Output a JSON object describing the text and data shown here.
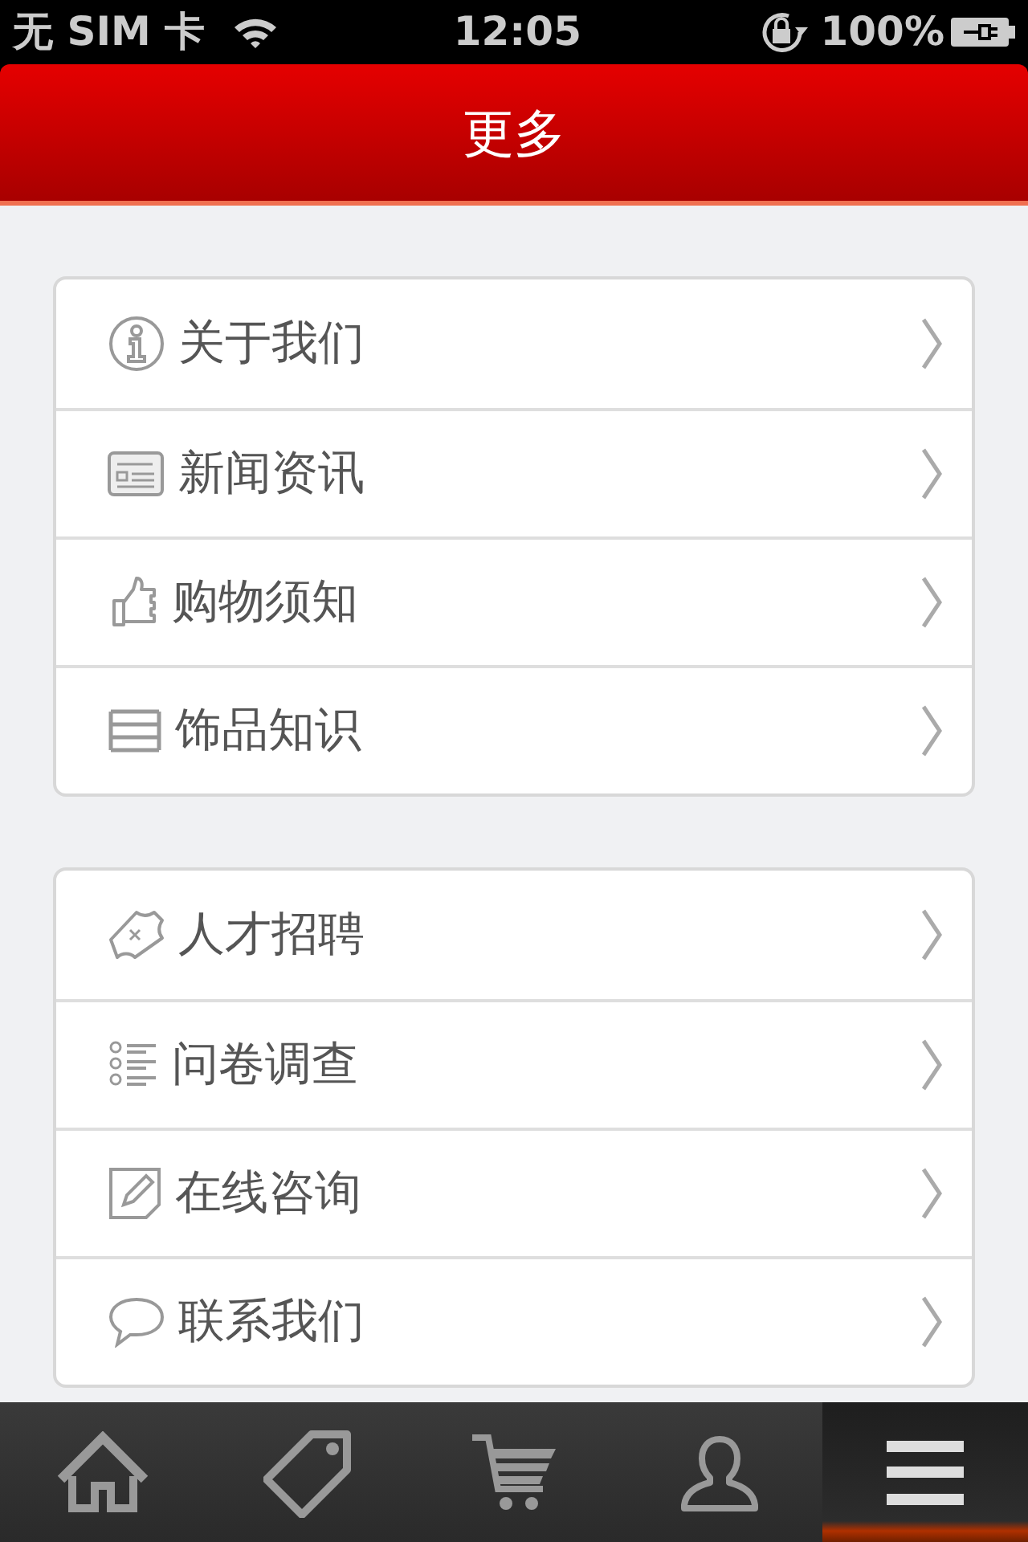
{
  "status_bar": {
    "carrier": "无 SIM 卡",
    "time": "12:05",
    "battery": "100%"
  },
  "header": {
    "title": "更多"
  },
  "groups": [
    {
      "items": [
        {
          "kind": "info",
          "label": "关于我们"
        },
        {
          "kind": "news",
          "label": "新闻资讯"
        },
        {
          "kind": "thumb",
          "label": "购物须知"
        },
        {
          "kind": "stack",
          "label": "饰品知识"
        }
      ]
    },
    {
      "items": [
        {
          "kind": "ticket",
          "label": "人才招聘"
        },
        {
          "kind": "checklist",
          "label": "问卷调查"
        },
        {
          "kind": "pencil",
          "label": "在线咨询"
        },
        {
          "kind": "bubble",
          "label": "联系我们"
        }
      ]
    }
  ],
  "tab_bar": [
    {
      "kind": "home",
      "selected": false
    },
    {
      "kind": "tag",
      "selected": false
    },
    {
      "kind": "cart",
      "selected": false
    },
    {
      "kind": "user",
      "selected": false
    },
    {
      "kind": "menu",
      "selected": true
    }
  ]
}
